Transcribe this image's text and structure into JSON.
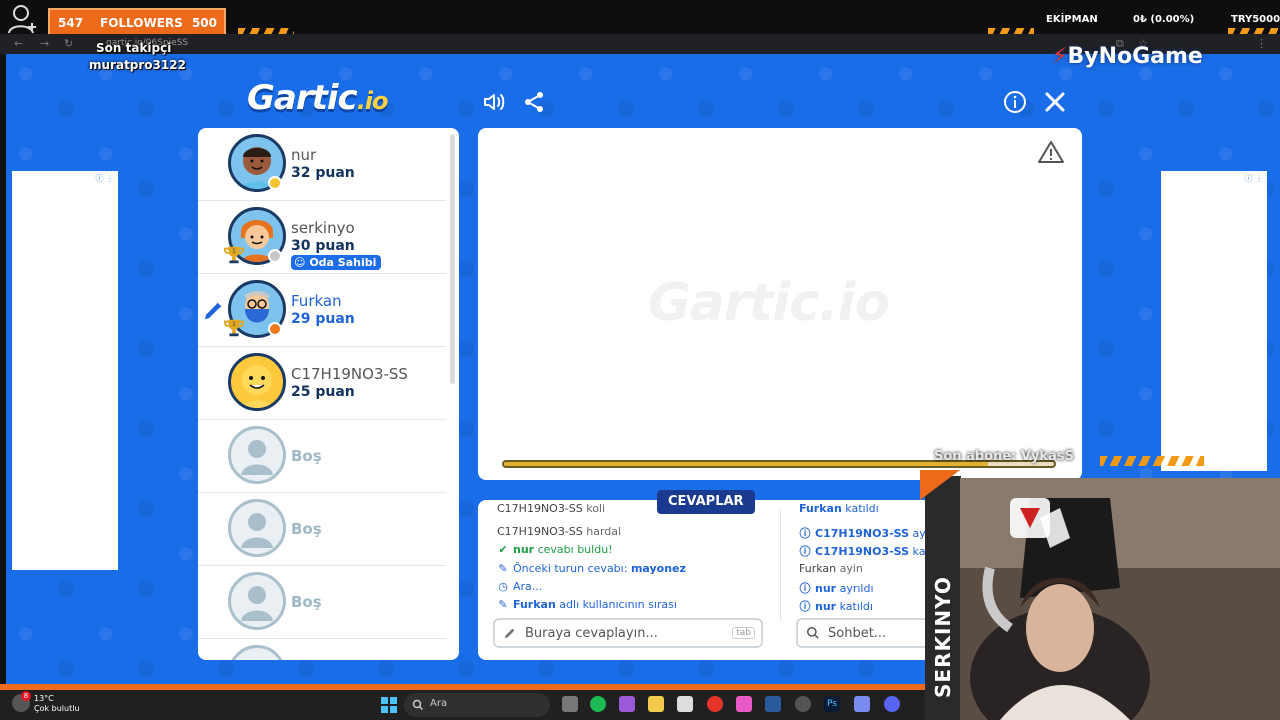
{
  "overlay": {
    "followers_count": "547",
    "followers_label": "FOLLOWERS",
    "followers_goal": "500",
    "son_takipci_label": "Son takipçi",
    "son_takipci_name": "muratpro3122",
    "equipment_label": "EKİPMAN",
    "equipment_value": "0₺ (0.00%)",
    "goal_label": "TRY5000",
    "brand": "ByNoGame",
    "son_abone": "Son abone: VykasS",
    "streamer_vertical": "SERKINYO"
  },
  "browser": {
    "url": "gartic.io/06SpjeSS"
  },
  "game": {
    "logo_main": "Gartic",
    "logo_io": ".io",
    "watermark": "Gartic.io",
    "players": [
      {
        "name": "nur",
        "score": "32 puan",
        "status_color": "#f4c430",
        "trophy": false,
        "drawing": false,
        "owner": false
      },
      {
        "name": "serkinyo",
        "score": "30 puan",
        "status_color": "#c8c8c8",
        "trophy": true,
        "drawing": false,
        "owner": true
      },
      {
        "name": "Furkan",
        "score": "29 puan",
        "status_color": "#ee7a1b",
        "trophy": true,
        "drawing": true,
        "owner": false
      },
      {
        "name": "C17H19NO3-SS",
        "score": "25 puan",
        "status_color": "",
        "trophy": false,
        "drawing": false,
        "owner": false
      },
      {
        "name": "Boş",
        "empty": true
      },
      {
        "name": "Boş",
        "empty": true
      },
      {
        "name": "Boş",
        "empty": true
      }
    ],
    "owner_badge": "Oda Sahibi",
    "answers_tab": "CEVAPLAR",
    "answers": {
      "line0_name": "C17H19NO3-SS",
      "line0_text": "koli",
      "line1_name": "C17H19NO3-SS",
      "line1_text": "hardal",
      "line2_name": "nur",
      "line2_text": "cevabı buldu!",
      "line3_text": "Önceki turun cevabı:",
      "line3_value": "mayonez",
      "line4_text": "Ara...",
      "line5_name": "Furkan",
      "line5_text": "adlı kullanıcının sırası"
    },
    "chat": {
      "line0_name": "Furkan",
      "line0_text": "katıldı",
      "line1_name": "C17H19NO3-SS",
      "line1_text": "ayrıldı",
      "line2_name": "C17H19NO3-SS",
      "line2_text": "katıldı",
      "line3_name": "Furkan",
      "line3_text": "ayin",
      "line4_name": "nur",
      "line4_text": "ayrıldı",
      "line5_name": "nur",
      "line5_text": "katıldı"
    },
    "answer_placeholder": "Buraya cevaplayın...",
    "answer_key_hint": "tab",
    "chat_placeholder": "Sohbet...",
    "timer_fraction": 0.88
  },
  "taskbar": {
    "temp": "13°C",
    "weather": "Çok bulutlu",
    "search_label": "Ara",
    "notif": "8"
  },
  "colors": {
    "page_blue": "#1a6de8",
    "accent_orange": "#ee6a1b",
    "active_blue": "#1e63d8",
    "tab_navy": "#1a3a8f"
  }
}
